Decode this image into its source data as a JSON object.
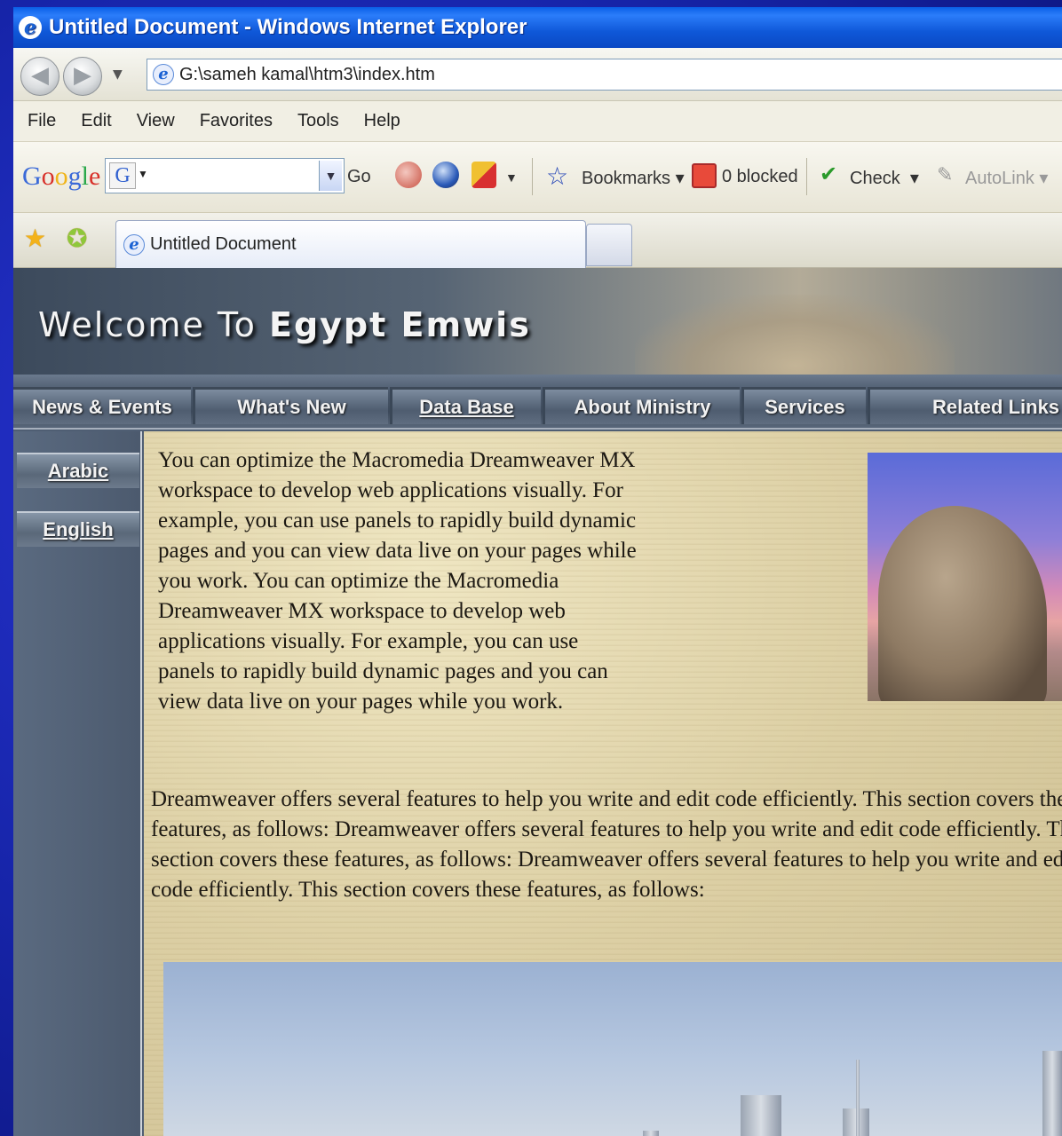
{
  "window": {
    "title": "Untitled Document - Windows Internet Explorer",
    "address": "G:\\sameh kamal\\htm3\\index.htm"
  },
  "menu": [
    "File",
    "Edit",
    "View",
    "Favorites",
    "Tools",
    "Help"
  ],
  "google_toolbar": {
    "logo": "Google",
    "search_g": "G",
    "go_label": "Go",
    "bookmarks_label": "Bookmarks",
    "blocked_label": "0 blocked",
    "check_label": "Check",
    "autolink_label": "AutoLink"
  },
  "tabs": [
    {
      "label": "Untitled Document"
    }
  ],
  "page": {
    "welcome_prefix": "Welcome To ",
    "welcome_bold": "Egypt Emwis",
    "nav": [
      "News & Events",
      "What's New",
      "Data Base",
      "About Ministry",
      "Services",
      "Related Links"
    ],
    "side": [
      "Arabic",
      "English"
    ],
    "para1": "You can optimize the Macromedia Dreamweaver MX workspace to develop web applications visually. For example, you can use panels to rapidly build dynamic pages and you can view data live on your pages while you work. You can optimize the Macromedia Dreamweaver MX workspace to develop web applications visually. For example, you can use panels to rapidly build dynamic pages and you can view data live on your pages while you work.",
    "para2": "Dreamweaver offers several features to help you write and edit code efficiently. This section covers these features, as follows: Dreamweaver offers several features to help you write and edit code efficiently. This section covers these features, as follows: Dreamweaver offers several features to help you write and edit code efficiently. This section covers these features, as follows:"
  }
}
